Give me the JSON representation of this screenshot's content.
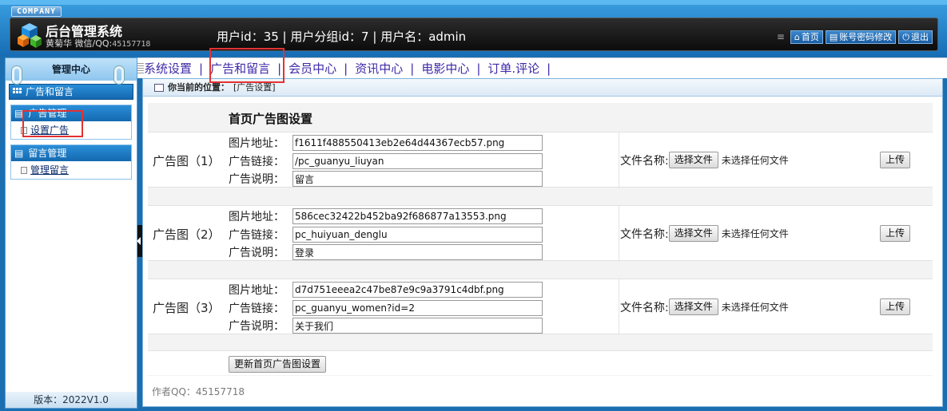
{
  "header": {
    "company": "COMPANY",
    "title": "后台管理系统",
    "subtitle": "黄菊华 微信/QQ:",
    "subtitle_num": "45157718",
    "user_info": "用户id：35 | 用户分组id：7 | 用户名：admin",
    "buttons": [
      "首页",
      "账号密码修改",
      "退出"
    ]
  },
  "sidebar": {
    "heading": "管理中心",
    "category": "广告和留言",
    "groups": [
      {
        "title": "广告管理",
        "items": [
          "设置广告"
        ]
      },
      {
        "title": "留言管理",
        "items": [
          "管理留言"
        ]
      }
    ],
    "version": "版本：2022V1.0"
  },
  "nav": [
    "系统设置",
    "广告和留言",
    "会员中心",
    "资讯中心",
    "电影中心",
    "订单.评论"
  ],
  "breadcrumb": {
    "label": "你当前的位置：",
    "value": "[广告设置]"
  },
  "content": {
    "title": "首页广告图设置",
    "field_labels": {
      "image": "图片地址：",
      "link": "广告链接：",
      "desc": "广告说明："
    },
    "file_label": "文件名称:",
    "choose_file": "选择文件",
    "no_file": "未选择任何文件",
    "upload": "上传",
    "ads": [
      {
        "label": "广告图（1）",
        "image": "f1611f488550413eb2e64d44367ecb57.png",
        "link": "/pc_guanyu_liuyan",
        "desc": "留言"
      },
      {
        "label": "广告图（2）",
        "image": "586cec32422b452ba92f686877a13553.png",
        "link": "pc_huiyuan_denglu",
        "desc": "登录"
      },
      {
        "label": "广告图（3）",
        "image": "d7d751eeea2c47be87e9c9a3791c4dbf.png",
        "link": "pc_guanyu_women?id=2",
        "desc": "关于我们"
      }
    ],
    "submit": "更新首页广告图设置",
    "author": "作者QQ：45157718"
  },
  "colors": {
    "header_blue": "#1f78c1",
    "nav_text": "#3d2aa8",
    "highlight": "#e23232"
  }
}
